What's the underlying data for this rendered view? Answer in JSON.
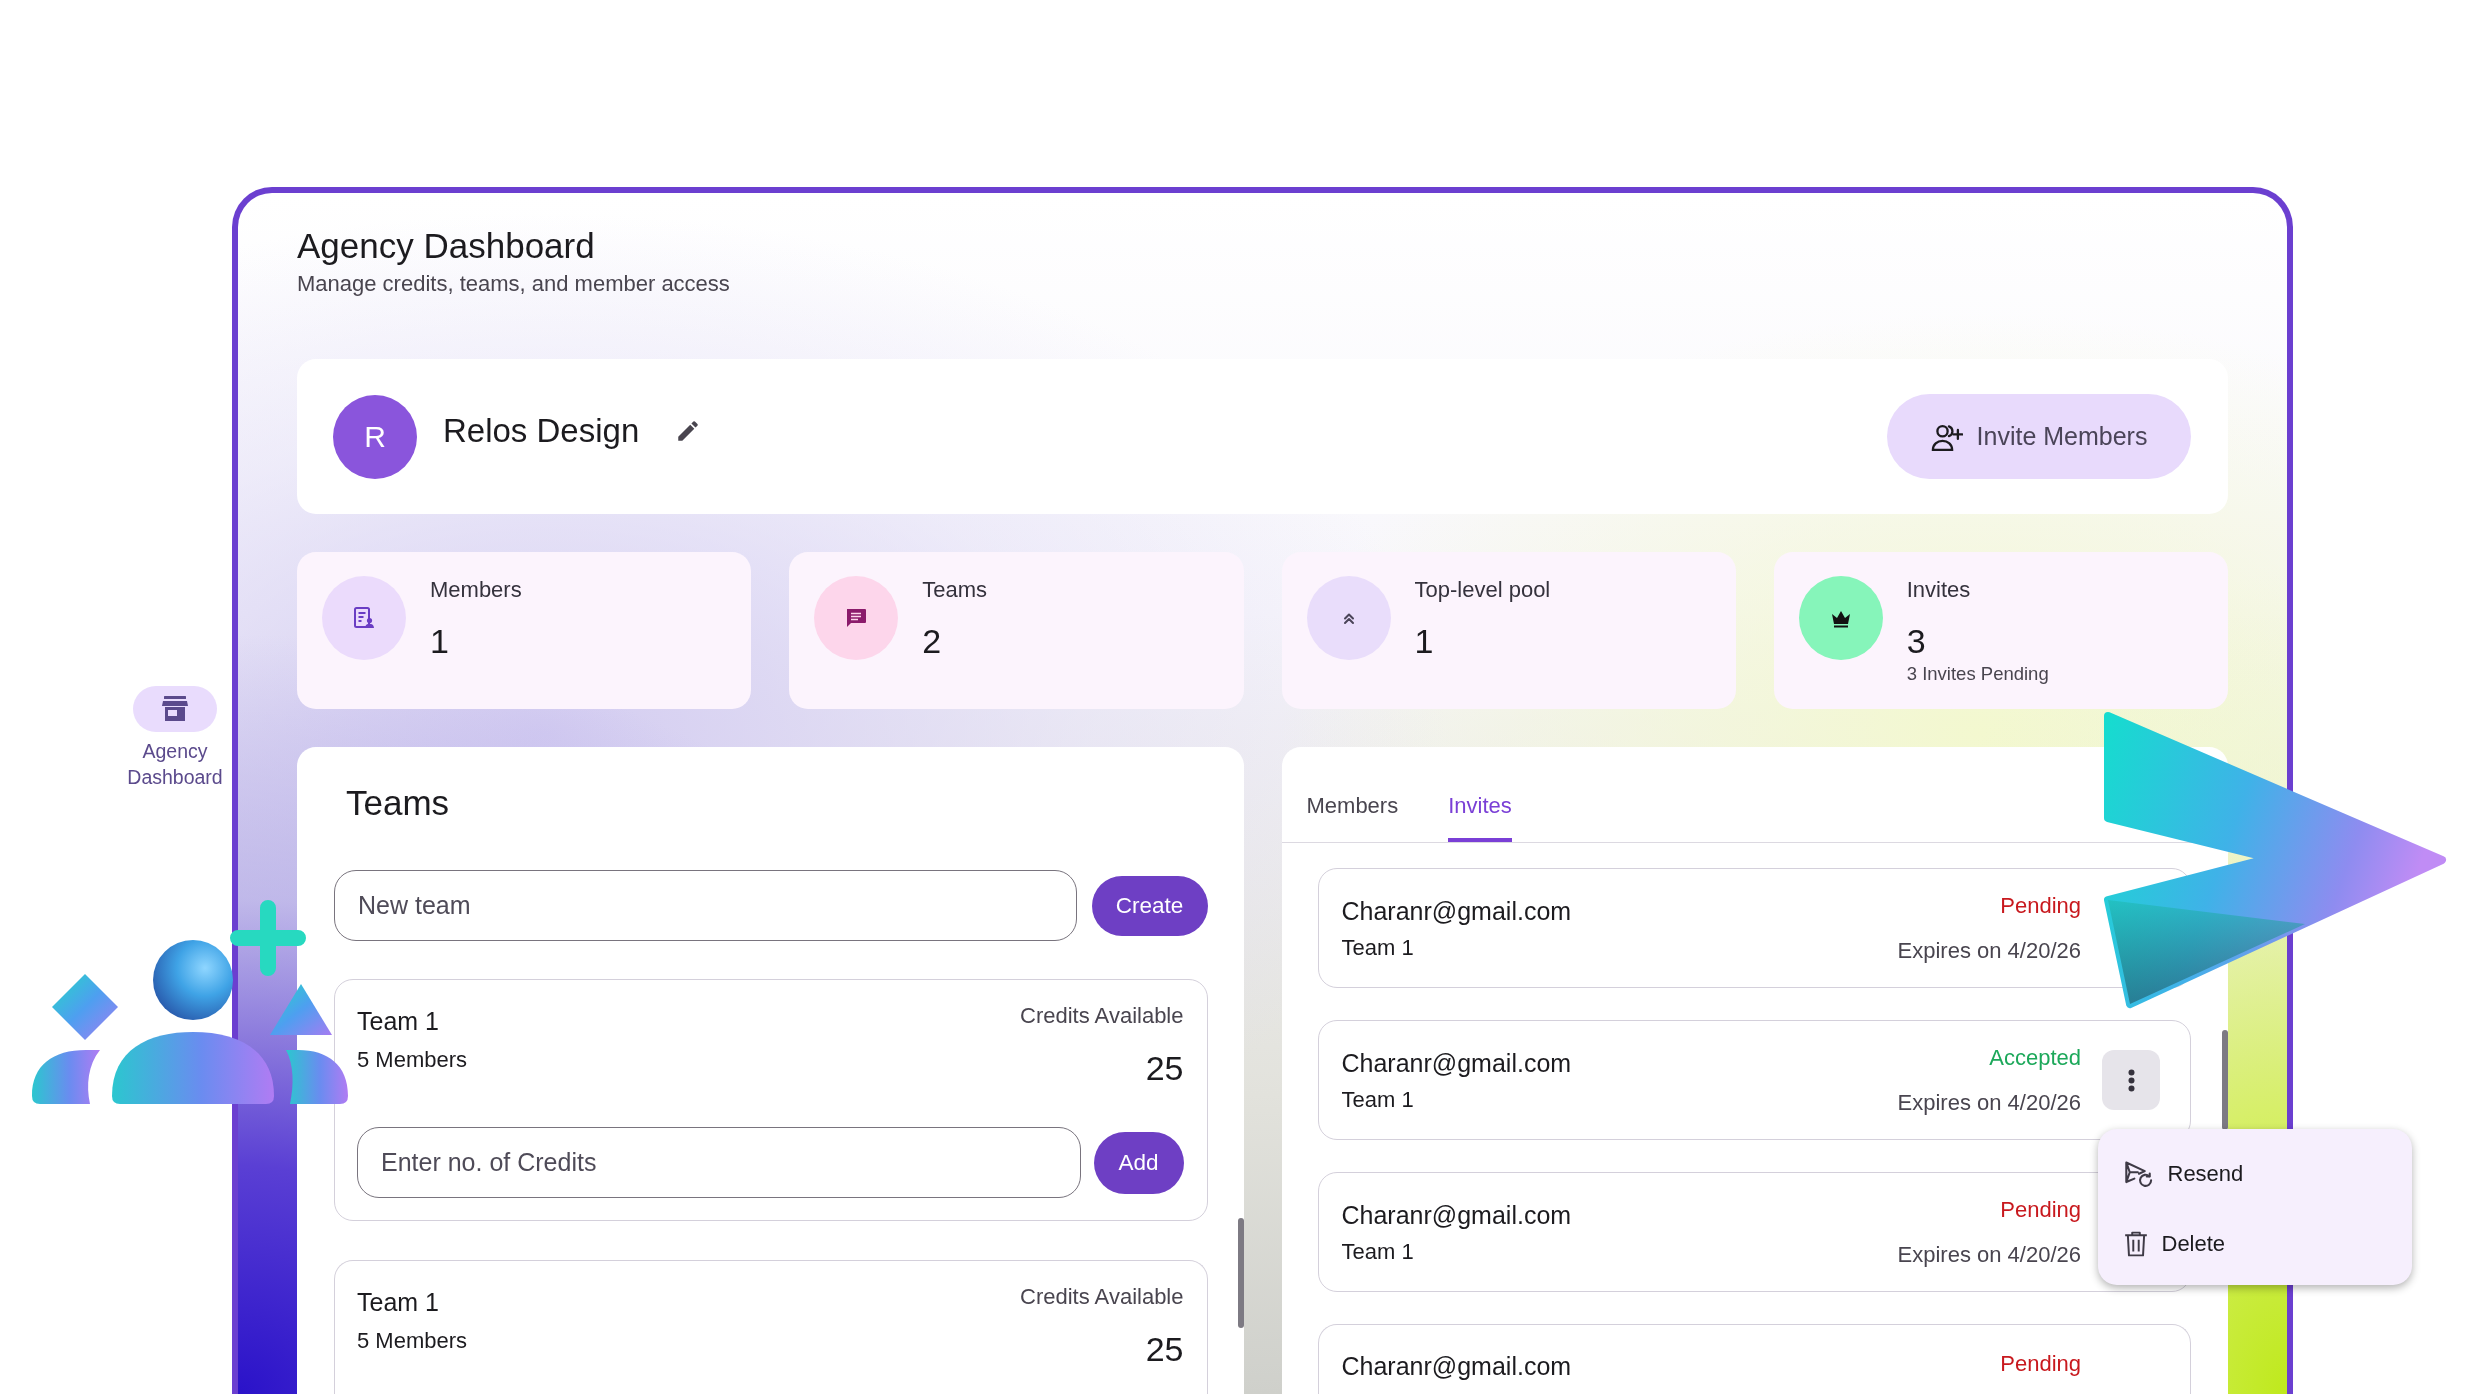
{
  "sidebar": {
    "items": [
      {
        "label": "Agency Dashboard",
        "selected": true
      }
    ]
  },
  "header": {
    "title": "Agency Dashboard",
    "subtitle": "Manage credits, teams, and member access"
  },
  "organization": {
    "initial": "R",
    "name": "Relos Design",
    "invite_button": "Invite Members"
  },
  "stats": [
    {
      "kind": "members",
      "label": "Members",
      "value": "1"
    },
    {
      "kind": "teams",
      "label": "Teams",
      "value": "2"
    },
    {
      "kind": "pool",
      "label": "Top-level pool",
      "value": "1"
    },
    {
      "kind": "invites",
      "label": "Invites",
      "value": "3",
      "note": "3 Invites Pending"
    }
  ],
  "teams_panel": {
    "title": "Teams",
    "new_team_field": {
      "placeholder": "New team"
    },
    "create_button": "Create",
    "teams": [
      {
        "name": "Team 1",
        "members": "5 Members",
        "credits_label": "Credits Available",
        "credits": "25",
        "credits_field": {
          "placeholder": "Enter no. of Credits"
        },
        "add_button": "Add"
      },
      {
        "name": "Team 1",
        "members": "5 Members",
        "credits_label": "Credits Available",
        "credits": "25"
      }
    ]
  },
  "invites_panel": {
    "tabs": [
      {
        "label": "Members",
        "selected": false
      },
      {
        "label": "Invites",
        "selected": true
      }
    ],
    "invites": [
      {
        "email": "Charanr@gmail.com",
        "team": "Team 1",
        "kind": "pending",
        "status": "Pending",
        "expires": "Expires on 4/20/26",
        "menu_open": false
      },
      {
        "email": "Charanr@gmail.com",
        "team": "Team 1",
        "kind": "accepted",
        "status": "Accepted",
        "expires": "Expires on 4/20/26",
        "menu_open": true
      },
      {
        "email": "Charanr@gmail.com",
        "team": "Team 1",
        "kind": "pending",
        "status": "Pending",
        "expires": "Expires on 4/20/26",
        "menu_open": false
      },
      {
        "email": "Charanr@gmail.com",
        "kind": "pending",
        "status": "Pending",
        "menu_open": false
      }
    ],
    "menu": {
      "items": [
        {
          "kind": "resend",
          "label": "Resend"
        },
        {
          "kind": "delete",
          "label": "Delete"
        }
      ]
    }
  }
}
